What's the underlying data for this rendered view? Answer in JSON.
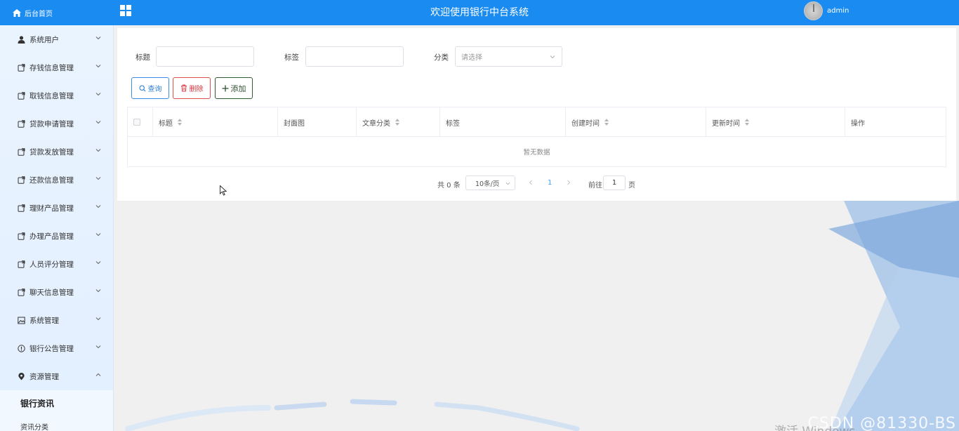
{
  "header": {
    "home_label": "后台首页",
    "title": "欢迎使用银行中台系统",
    "username": "admin",
    "colors": {
      "primary": "#1a8bf0"
    }
  },
  "sidebar": {
    "items": [
      {
        "label": "系统用户",
        "icon": "user-icon",
        "expanded": false
      },
      {
        "label": "存钱信息管理",
        "icon": "export-icon",
        "expanded": false
      },
      {
        "label": "取钱信息管理",
        "icon": "export-icon",
        "expanded": false
      },
      {
        "label": "贷款申请管理",
        "icon": "export-icon",
        "expanded": false
      },
      {
        "label": "贷款发放管理",
        "icon": "export-icon",
        "expanded": false
      },
      {
        "label": "还款信息管理",
        "icon": "export-icon",
        "expanded": false
      },
      {
        "label": "理财产品管理",
        "icon": "export-icon",
        "expanded": false
      },
      {
        "label": "办理产品管理",
        "icon": "export-icon",
        "expanded": false
      },
      {
        "label": "人员评分管理",
        "icon": "export-icon",
        "expanded": false
      },
      {
        "label": "聊天信息管理",
        "icon": "export-icon",
        "expanded": false
      },
      {
        "label": "系统管理",
        "icon": "picture-icon",
        "expanded": false
      },
      {
        "label": "银行公告管理",
        "icon": "info-circle-icon",
        "expanded": false
      },
      {
        "label": "资源管理",
        "icon": "location-icon",
        "expanded": true
      }
    ],
    "subitems": [
      {
        "label": "银行资讯",
        "active": true
      },
      {
        "label": "资讯分类",
        "active": false
      }
    ]
  },
  "search": {
    "title_label": "标题",
    "title_value": "",
    "tag_label": "标签",
    "tag_value": "",
    "category_label": "分类",
    "category_placeholder": "请选择"
  },
  "actions": {
    "query": "查询",
    "delete": "删除",
    "add": "添加"
  },
  "table": {
    "columns": [
      "标题",
      "封面图",
      "文章分类",
      "标签",
      "创建时间",
      "更新时间",
      "操作"
    ],
    "sortable": [
      true,
      false,
      true,
      false,
      true,
      true,
      false
    ],
    "rows": [],
    "empty_text": "暂无数据"
  },
  "pagination": {
    "total_text": "共 0 条",
    "page_size": "10条/页",
    "current_page": "1",
    "goto_label": "前往",
    "goto_value": "1",
    "page_suffix": "页"
  },
  "overlay": {
    "watermark": "CSDN @81330-BS",
    "windows_activate": "激活 Windows"
  }
}
